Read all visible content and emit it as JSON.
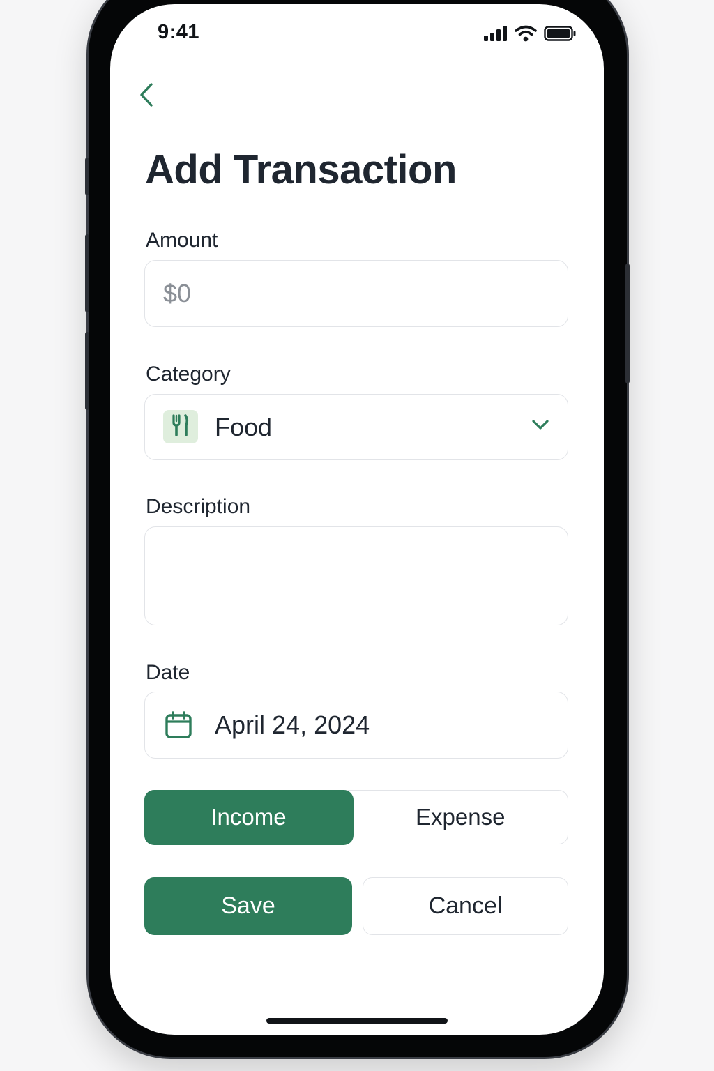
{
  "status_bar": {
    "time": "9:41",
    "icons": [
      "cellular-signal-icon",
      "wifi-icon",
      "battery-icon"
    ]
  },
  "header": {
    "back_icon": "chevron-left-icon",
    "title": "Add Transaction"
  },
  "form": {
    "amount": {
      "label": "Amount",
      "value": "",
      "placeholder": "$0"
    },
    "category": {
      "label": "Category",
      "selected": "Food",
      "icon": "fork-knife-icon",
      "dropdown_icon": "chevron-down-icon"
    },
    "description": {
      "label": "Description",
      "value": ""
    },
    "date": {
      "label": "Date",
      "value": "April 24, 2024",
      "icon": "calendar-icon"
    },
    "type_toggle": {
      "options": [
        "Income",
        "Expense"
      ],
      "selected": "Income"
    }
  },
  "actions": {
    "save_label": "Save",
    "cancel_label": "Cancel"
  },
  "colors": {
    "accent": "#2e7d5b",
    "accent_light": "#dfeedd",
    "text": "#1f2630",
    "placeholder": "#8a8f96",
    "border": "#e2e4e8"
  }
}
